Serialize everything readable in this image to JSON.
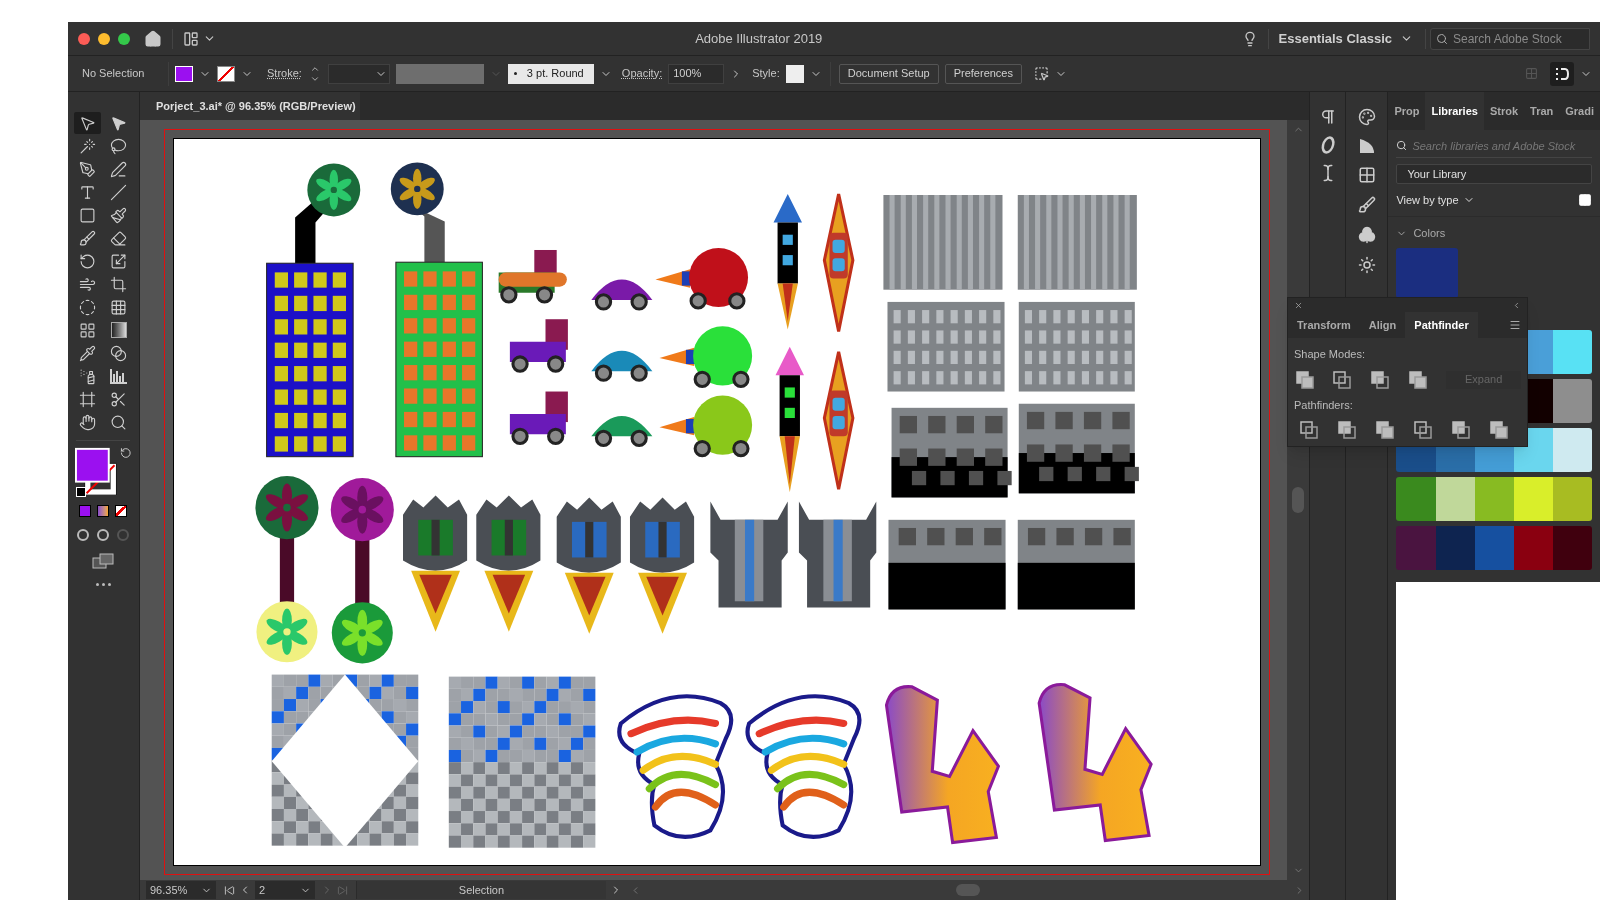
{
  "window": {
    "title": "Adobe Illustrator 2019"
  },
  "workspace": {
    "label": "Essentials Classic"
  },
  "stock_search": {
    "placeholder": "Search Adobe Stock"
  },
  "control_bar": {
    "selection": "No Selection",
    "stroke_label": "Stroke:",
    "brush": "3 pt. Round",
    "opacity_label": "Opacity:",
    "opacity": "100%",
    "style_label": "Style:",
    "buttons": [
      "Document Setup",
      "Preferences"
    ]
  },
  "document_tab": {
    "title": "Porject_3.ai* @ 96.35% (RGB/Preview)"
  },
  "tools": [
    {
      "kind": "selection",
      "selected": true
    },
    {
      "kind": "direct",
      "selected": false
    },
    {
      "kind": "wand",
      "selected": false
    },
    {
      "kind": "lasso",
      "selected": false
    },
    {
      "kind": "pen",
      "selected": false
    },
    {
      "kind": "curvature",
      "selected": false
    },
    {
      "kind": "type",
      "selected": false
    },
    {
      "kind": "line",
      "selected": false
    },
    {
      "kind": "rectangle",
      "selected": false
    },
    {
      "kind": "paintbrush",
      "selected": false
    },
    {
      "kind": "blob",
      "selected": false
    },
    {
      "kind": "eraser",
      "selected": false
    },
    {
      "kind": "rotate",
      "selected": false
    },
    {
      "kind": "scale",
      "selected": false
    },
    {
      "kind": "warp",
      "selected": false
    },
    {
      "kind": "transform",
      "selected": false
    },
    {
      "kind": "builder",
      "selected": false
    },
    {
      "kind": "perspective",
      "selected": false
    },
    {
      "kind": "mesh",
      "selected": false
    },
    {
      "kind": "gradient",
      "selected": false
    },
    {
      "kind": "eyedropper",
      "selected": false
    },
    {
      "kind": "blend",
      "selected": false
    },
    {
      "kind": "spray",
      "selected": false
    },
    {
      "kind": "graph",
      "selected": false
    },
    {
      "kind": "artboard",
      "selected": false
    },
    {
      "kind": "slice",
      "selected": false
    },
    {
      "kind": "hand",
      "selected": false
    },
    {
      "kind": "zoom",
      "selected": false
    }
  ],
  "status_bar": {
    "zoom": "96.35%",
    "artboard": "2",
    "tool": "Selection"
  },
  "libraries_panel": {
    "tabs": [
      {
        "label": "Prop",
        "selected": false
      },
      {
        "label": "Libraries",
        "selected": true
      },
      {
        "label": "Strok",
        "selected": false
      },
      {
        "label": "Tran",
        "selected": false
      },
      {
        "label": "Gradi",
        "selected": false
      }
    ],
    "search": {
      "placeholder": "Search libraries and Adobe Stock"
    },
    "library": "Your Library",
    "view": "View by type",
    "section": {
      "label": "Colors",
      "expanded": true
    },
    "swatch": {
      "color": "#1b2e80"
    },
    "color_themes": [
      {
        "swatches": [
          {
            "color": "#4a9fd8"
          },
          {
            "color": "#58e1f4"
          }
        ]
      },
      {
        "swatches": [
          {
            "color": "#120000"
          },
          {
            "color": "#8e8e8e"
          }
        ]
      },
      {
        "swatches": [
          {
            "color": "#1a4e8a"
          },
          {
            "color": "#2a6ea8"
          },
          {
            "color": "#449dd6"
          },
          {
            "color": "#6ad6ee"
          },
          {
            "color": "#cfeaf0"
          }
        ]
      },
      {
        "swatches": [
          {
            "color": "#3a8a1e"
          },
          {
            "color": "#c0d89a"
          },
          {
            "color": "#88bb22"
          },
          {
            "color": "#d9ee2a"
          },
          {
            "color": "#a8bc22"
          }
        ]
      },
      {
        "swatches": [
          {
            "color": "#4a1440"
          },
          {
            "color": "#0e2450"
          },
          {
            "color": "#1650a0"
          },
          {
            "color": "#8a0010"
          },
          {
            "color": "#40000e"
          }
        ]
      }
    ]
  },
  "pathfinder_panel": {
    "tabs": [
      {
        "label": "Transform",
        "selected": false
      },
      {
        "label": "Align",
        "selected": false
      },
      {
        "label": "Pathfinder",
        "selected": true
      }
    ],
    "shape_modes_label": "Shape Modes:",
    "expand": {
      "label": "Expand",
      "disabled": true
    },
    "pathfinders_label": "Pathfinders:"
  }
}
